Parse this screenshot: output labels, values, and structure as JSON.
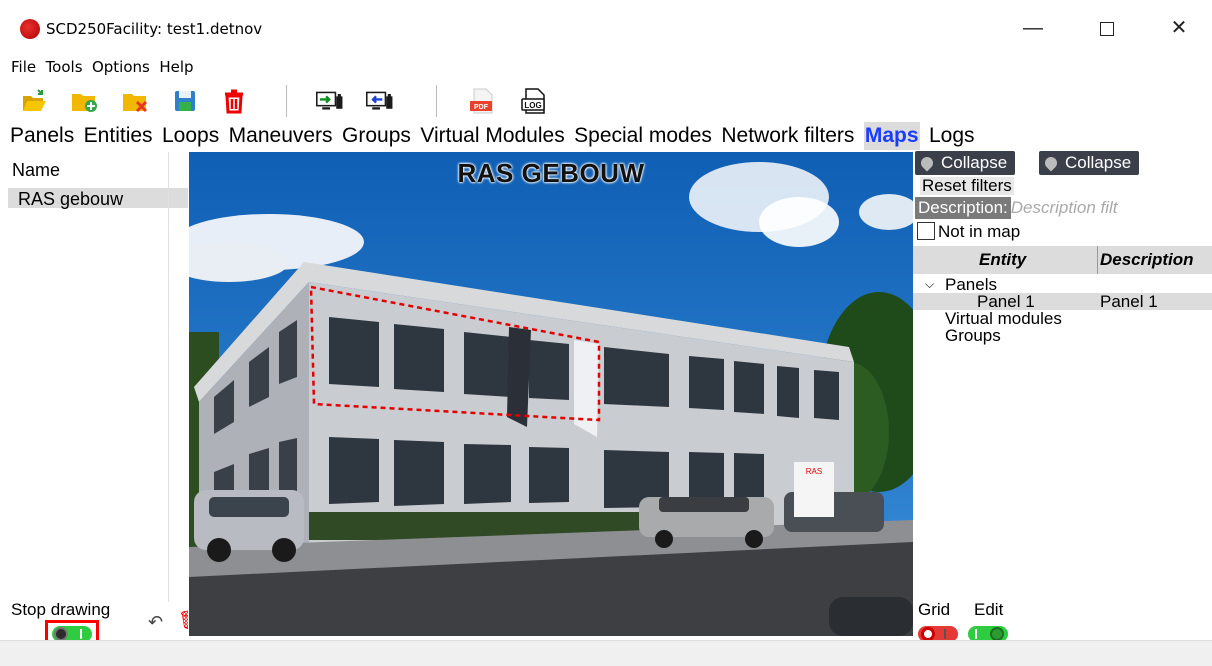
{
  "window": {
    "title": "SCD250Facility: test1.detnov",
    "minimize_glyph": "—",
    "close_glyph": "✕"
  },
  "menu": [
    "File",
    "Tools",
    "Options",
    "Help"
  ],
  "toolbar": {
    "icons": [
      "open-folder-icon",
      "new-folder-icon",
      "close-file-icon",
      "save-icon",
      "delete-icon",
      "upload-to-panel-icon",
      "download-from-panel-icon",
      "pdf-export-icon",
      "log-icon"
    ],
    "pdf_text": "PDF",
    "log_text": "LOG"
  },
  "tabs": [
    "Panels",
    "Entities",
    "Loops",
    "Maneuvers",
    "Groups",
    "Virtual Modules",
    "Special modes",
    "Network filters",
    "Maps",
    "Logs"
  ],
  "active_tab": "Maps",
  "left_panel": {
    "column_header": "Name",
    "rows": [
      "RAS gebouw"
    ]
  },
  "map": {
    "title": "RAS GEBOUW",
    "sign_text": "RAS"
  },
  "right_panel": {
    "collapse_1": "Collapse",
    "collapse_2": "Collapse",
    "reset_filters": "Reset filters",
    "description_label": "Description:",
    "description_placeholder": "Description filt",
    "not_in_map": "Not in map",
    "columns": [
      "Entity",
      "Description"
    ],
    "tree": {
      "panels_label": "Panels",
      "panel_1_entity": "Panel 1",
      "panel_1_desc": "Panel 1",
      "virtual_modules": "Virtual modules",
      "groups": "Groups"
    }
  },
  "bottom": {
    "stop_drawing": "Stop drawing",
    "stop_drawing_on": true,
    "grid_label": "Grid",
    "grid_on": false,
    "edit_label": "Edit",
    "edit_on": true
  },
  "colors": {
    "active_tab_text": "#1a3cff",
    "toggle_on": "#2ecc40",
    "toggle_off": "#e53935",
    "highlight_border": "#ff0000",
    "collapse_button_bg": "#3a3f4a"
  }
}
